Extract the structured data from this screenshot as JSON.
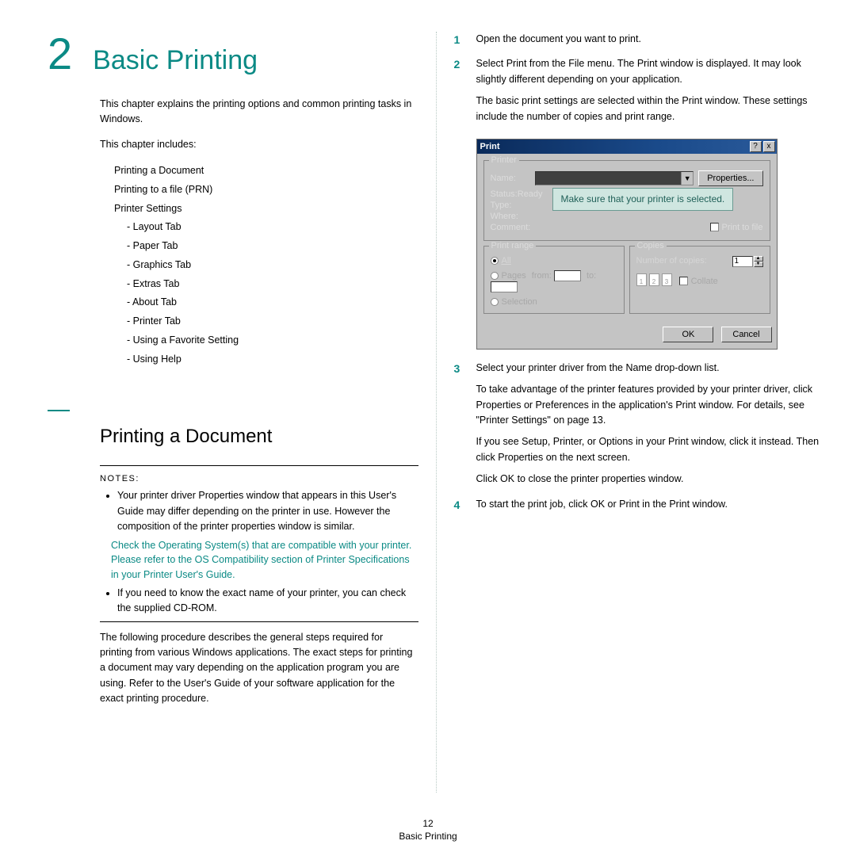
{
  "chapter": {
    "number": "2",
    "title": "Basic Printing"
  },
  "intro": "This chapter explains the printing options and common printing tasks in Windows.",
  "includes_label": "This chapter includes:",
  "toc": [
    "Printing a Document",
    "Printing to a file (PRN)",
    "Printer Settings"
  ],
  "toc_sub": [
    "- Layout Tab",
    "- Paper Tab",
    "- Graphics Tab",
    "- Extras Tab",
    "- About Tab",
    "- Printer Tab",
    "- Using a Favorite Setting",
    "- Using Help"
  ],
  "section1": {
    "title": "Printing a Document",
    "notes_label": "NOTES:",
    "note1": "Your printer driver Properties window that appears in this User's Guide may differ depending on the printer in use. However the composition of the printer properties window is similar.",
    "note_teal": "Check the Operating System(s) that are compatible with your printer. Please refer to the OS Compatibility section of Printer Specifications in your Printer User's Guide.",
    "note2": "If you need to know the exact name of your printer, you can check the supplied CD-ROM.",
    "para": "The following procedure describes the general steps required for printing from various Windows applications. The exact steps for printing a document may vary depending on the application program you are using. Refer to the User's Guide of your software application for the exact printing procedure."
  },
  "steps": {
    "s1": "Open the document you want to print.",
    "s2a": "Select Print from the File menu. The Print window is displayed. It may look slightly different depending on your application.",
    "s2b": "The basic print settings are selected within the Print window. These settings include the number of copies and print range.",
    "s3a": "Select your printer driver from the Name drop-down list.",
    "s3b": "To take advantage of the printer features provided by your printer driver, click Properties or Preferences in the application's Print window. For details, see \"Printer Settings\" on page 13.",
    "s3c": "If you see Setup, Printer, or Options in your Print window, click it instead. Then click Properties on the next screen.",
    "s3d": "Click OK to close the printer properties window.",
    "s4": "To start the print job, click OK or Print in the Print window."
  },
  "dialog": {
    "title": "Print",
    "help": "?",
    "close": "x",
    "printer_group": "Printer",
    "name_label": "Name:",
    "properties_btn": "Properties...",
    "status_label": "Status:",
    "status_value": "Ready",
    "type_label": "Type:",
    "where_label": "Where:",
    "comment_label": "Comment:",
    "print_to_file": "Print to file",
    "range_group": "Print range",
    "all": "All",
    "pages": "Pages",
    "from": "from:",
    "to": "to:",
    "selection": "Selection",
    "copies_group": "Copies",
    "num_copies": "Number of copies:",
    "copies_value": "1",
    "collate": "Collate",
    "ok": "OK",
    "cancel": "Cancel",
    "callout": "Make sure that your printer is selected."
  },
  "footer": {
    "page": "12",
    "title": "Basic Printing"
  }
}
